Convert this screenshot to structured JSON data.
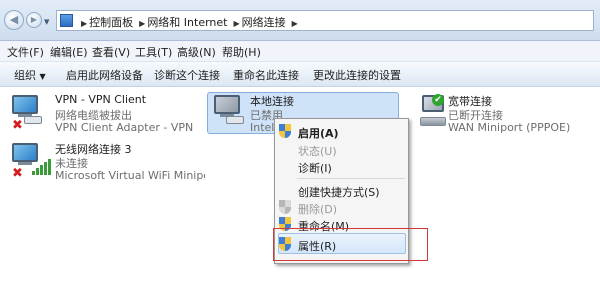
{
  "address_bar": {
    "back_icon": "back-arrow-icon",
    "forward_icon": "forward-arrow-icon",
    "breadcrumb": [
      "控制面板",
      "网络和 Internet",
      "网络连接"
    ]
  },
  "menubar": [
    "文件(F)",
    "编辑(E)",
    "查看(V)",
    "工具(T)",
    "高级(N)",
    "帮助(H)"
  ],
  "toolbar": {
    "organize": "组织",
    "actions": [
      "启用此网络设备",
      "诊断这个连接",
      "重命名此连接",
      "更改此连接的设置"
    ]
  },
  "connections": [
    {
      "name": "VPN - VPN Client",
      "status": "网络电缆被拔出",
      "adapter": "VPN Client Adapter - VPN",
      "state_icon": "red-x-icon"
    },
    {
      "name": "本地连接",
      "status": "已禁用",
      "adapter": "Intel",
      "state_icon": "none",
      "selected": true
    },
    {
      "name": "宽带连接",
      "status": "已断开连接",
      "adapter": "WAN Miniport (PPPOE)",
      "state_icon": "green-check-icon"
    },
    {
      "name": "无线网络连接 3",
      "status": "未连接",
      "adapter": "Microsoft Virtual WiFi Miniport",
      "state_icon": "red-x-icon"
    }
  ],
  "context_menu": [
    {
      "label": "启用(A)",
      "bold": true,
      "disabled": false,
      "shield": true
    },
    {
      "label": "状态(U)",
      "bold": false,
      "disabled": true,
      "shield": false
    },
    {
      "label": "诊断(I)",
      "bold": false,
      "disabled": false,
      "shield": false
    },
    {
      "label": "创建快捷方式(S)",
      "bold": false,
      "disabled": false,
      "shield": false
    },
    {
      "label": "删除(D)",
      "bold": false,
      "disabled": true,
      "shield": true
    },
    {
      "label": "重命名(M)",
      "bold": false,
      "disabled": false,
      "shield": true
    },
    {
      "label": "属性(R)",
      "bold": false,
      "disabled": false,
      "shield": true,
      "highlighted": true
    }
  ],
  "colors": {
    "selection": "#cfe3f8",
    "highlight_box": "#d23a3a",
    "accent": "#2e7fc8"
  }
}
